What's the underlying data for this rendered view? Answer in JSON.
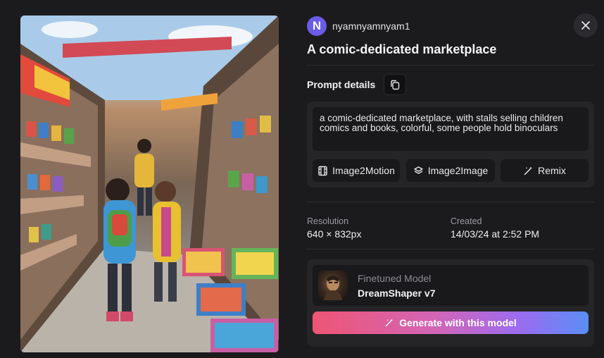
{
  "author": {
    "initial": "N",
    "username": "nyamnyamnyam1",
    "avatar_color": "#6b5ce7"
  },
  "title": "A comic-dedicated marketplace",
  "prompt": {
    "header": "Prompt details",
    "text": "a comic-dedicated marketplace, with stalls selling children comics and books, colorful, some people hold binoculars"
  },
  "actions": [
    {
      "label": "Image2Motion",
      "icon": "film-icon"
    },
    {
      "label": "Image2Image",
      "icon": "layers-icon"
    },
    {
      "label": "Remix",
      "icon": "magic-wand-icon"
    }
  ],
  "meta": {
    "resolution_label": "Resolution",
    "resolution_value": "640 × 832px",
    "created_label": "Created",
    "created_value": "14/03/24 at 2:52 PM"
  },
  "model": {
    "label": "Finetuned Model",
    "name": "DreamShaper v7",
    "generate_label": "Generate with this model"
  },
  "colors": {
    "background": "#1b1b1d",
    "card": "#252528",
    "inner": "#19191b",
    "gradient_start": "#ee5574",
    "gradient_end": "#5b8ef5"
  }
}
